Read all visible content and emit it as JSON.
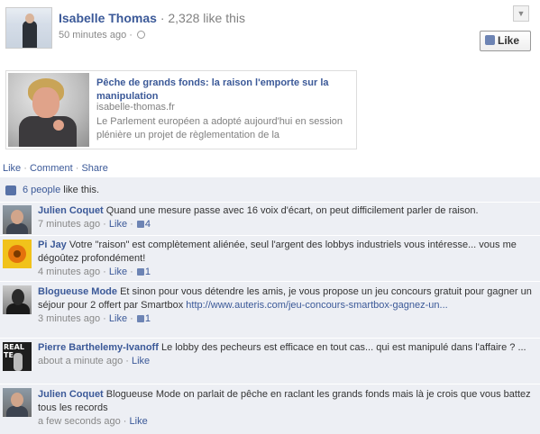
{
  "post": {
    "author": "Isabelle Thomas",
    "like_count": "· 2,328 like this",
    "time": "50 minutes ago",
    "time_sep": "·",
    "like_button": "Like"
  },
  "link": {
    "title": "Pêche de grands fonds: la raison l'emporte sur la manipulation",
    "url": "isabelle-thomas.fr",
    "description": "Le Parlement européen a adopté aujourd'hui en session plénière un projet de règlementation de la"
  },
  "actions": {
    "like": "Like",
    "comment": "Comment",
    "share": "Share",
    "sep": "·"
  },
  "likes_summary": {
    "people": "6 people",
    "suffix": " like this."
  },
  "comments": [
    {
      "author": "Julien Coquet",
      "text": " Quand une mesure passe avec 16 voix d'écart, on peut difficilement parler de raison.",
      "time": "7 minutes ago",
      "like": "Like",
      "likes": "4"
    },
    {
      "author": "Pi Jay",
      "text": " Votre \"raison\" est complètement aliénée, seul l'argent des lobbys industriels vous intéresse... vous me dégoûtez profondément!",
      "time": "4 minutes ago",
      "like": "Like",
      "likes": "1"
    },
    {
      "author": "Blogueuse Mode",
      "text": " Et sinon pour vous détendre les amis, je vous propose un jeu concours gratuit pour gagner un séjour pour 2 offert par Smartbox ",
      "link": "http://www.auteris.com/jeu-concours-smartbox-gagnez-un...",
      "time": "3 minutes ago",
      "like": "Like",
      "likes": "1"
    },
    {
      "author": "Pierre Barthelemy-Ivanoff",
      "text": " Le lobby des pecheurs est efficace en tout cas... qui est manipulé dans l'affaire ? ...",
      "time": "about a minute ago",
      "like": "Like"
    },
    {
      "author": "Julien Coquet",
      "text": " Blogueuse Mode on parlait de pêche en raclant les grands fonds mais là je crois que vous battez tous les records",
      "time": "a few seconds ago",
      "like": "Like"
    }
  ],
  "pierre_avatar_text": "REAL TE"
}
